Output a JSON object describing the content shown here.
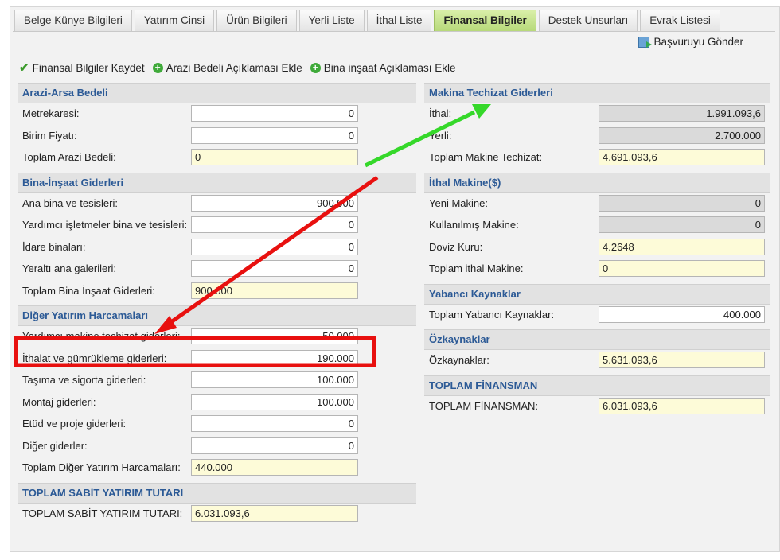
{
  "tabs": [
    {
      "label": "Belge Künye Bilgileri",
      "active": false
    },
    {
      "label": "Yatırım Cinsi",
      "active": false
    },
    {
      "label": "Ürün Bilgileri",
      "active": false
    },
    {
      "label": "Yerli Liste",
      "active": false
    },
    {
      "label": "İthal Liste",
      "active": false
    },
    {
      "label": "Finansal Bilgiler",
      "active": true
    },
    {
      "label": "Destek Unsurları",
      "active": false
    },
    {
      "label": "Evrak Listesi",
      "active": false
    }
  ],
  "actions": {
    "submit_label": "Başvuruyu Gönder"
  },
  "toolbar": {
    "save_label": "Finansal Bilgiler Kaydet",
    "add_land_label": "Arazi Bedeli Açıklaması Ekle",
    "add_building_label": "Bina inşaat Açıklaması Ekle"
  },
  "land": {
    "title": "Arazi-Arsa Bedeli",
    "square_meters": {
      "label": "Metrekaresi:",
      "value": "0"
    },
    "unit_price": {
      "label": "Birim Fiyatı:",
      "value": "0"
    },
    "total": {
      "label": "Toplam Arazi Bedeli:",
      "value": "0"
    }
  },
  "building": {
    "title": "Bina-İnşaat Giderleri",
    "main": {
      "label": "Ana bina ve tesisleri:",
      "value": "900.000"
    },
    "auxiliary": {
      "label": "Yardımcı işletmeler bina ve tesisleri:",
      "value": "0"
    },
    "admin": {
      "label": "İdare binaları:",
      "value": "0"
    },
    "underground": {
      "label": "Yeraltı ana galerileri:",
      "value": "0"
    },
    "total": {
      "label": "Toplam Bina İnşaat Giderleri:",
      "value": "900.000"
    }
  },
  "other": {
    "title": "Diğer Yatırım Harcamaları",
    "aux_machine": {
      "label": "Yardımcı makine techizat giderleri:",
      "value": "50.000"
    },
    "import_customs": {
      "label": "İthalat ve gümrükleme giderleri:",
      "value": "190.000"
    },
    "transport": {
      "label": "Taşıma ve sigorta giderleri:",
      "value": "100.000"
    },
    "assembly": {
      "label": "Montaj giderleri:",
      "value": "100.000"
    },
    "study": {
      "label": "Etüd ve proje giderleri:",
      "value": "0"
    },
    "misc": {
      "label": "Diğer giderler:",
      "value": "0"
    },
    "total": {
      "label": "Toplam Diğer Yatırım Harcamaları:",
      "value": "440.000"
    }
  },
  "fixed_total": {
    "title": "TOPLAM SABİT YATIRIM TUTARI",
    "total": {
      "label": "TOPLAM SABİT YATIRIM TUTARI:",
      "value": "6.031.093,6"
    }
  },
  "machinery": {
    "title": "Makina Techizat Giderleri",
    "imported": {
      "label": "İthal:",
      "value": "1.991.093,6"
    },
    "domestic": {
      "label": "Yerli:",
      "value": "2.700.000"
    },
    "total": {
      "label": "Toplam Makine Techizat:",
      "value": "4.691.093,6"
    }
  },
  "imported_machinery": {
    "title": "İthal Makine($)",
    "new": {
      "label": "Yeni Makine:",
      "value": "0"
    },
    "used": {
      "label": "Kullanılmış Makine:",
      "value": "0"
    },
    "fx_rate": {
      "label": "Doviz Kuru:",
      "value": "4.2648"
    },
    "total": {
      "label": "Toplam ithal Makine:",
      "value": "0"
    }
  },
  "foreign_funds": {
    "title": "Yabancı Kaynaklar",
    "total": {
      "label": "Toplam Yabancı Kaynaklar:",
      "value": "400.000"
    }
  },
  "equity": {
    "title": "Özkaynaklar",
    "total": {
      "label": "Özkaynaklar:",
      "value": "5.631.093,6"
    }
  },
  "financing": {
    "title": "TOPLAM FİNANSMAN",
    "total": {
      "label": "TOPLAM FİNANSMAN:",
      "value": "6.031.093,6"
    }
  },
  "colors": {
    "section_title": "#2c5a96",
    "active_tab": "#b7d97a",
    "total_field_bg": "#fdfbd8",
    "readonly_field_bg": "#dadada",
    "annotation_red": "#e8100f",
    "annotation_green": "#35d82a"
  },
  "icons": {
    "save": "check-icon",
    "add": "plus-circle-icon",
    "submit": "send-document-icon"
  }
}
